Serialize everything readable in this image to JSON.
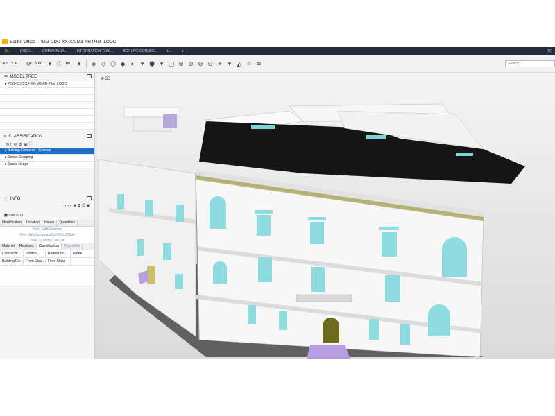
{
  "app": {
    "title": "Solibri Office - PDG-CDC-XX-XX-M3-AR-Pilot_LODC",
    "tabs": [
      "N...",
      "CHEC...",
      "COMMUNICA...",
      "INFORMATION TAKE...",
      "BCF LIVE CONNEC...",
      "L..."
    ],
    "tab_plus": "+",
    "right_label": "TO"
  },
  "toolbar": {
    "spin_label": "Spin",
    "info_label": "Info",
    "search_placeholder": "Search"
  },
  "model_tree": {
    "title": "MODEL TREE",
    "items": [
      "PDG-CDC-XX-XX-M3-AR-Pilot_LODC"
    ]
  },
  "classification": {
    "title": "CLASSIFICATION",
    "items": [
      "Building Elements - General",
      "Space Grouping",
      "Space Usage"
    ]
  },
  "info": {
    "title": "INFO",
    "selected": "Slab.0.16",
    "tabs": [
      "Identification",
      "Location",
      "Issues",
      "Quantities"
    ],
    "links": [
      "Pset_SlabCommon",
      "Pset_ReinforcementBarPitchOfSlab",
      "Pset_QuantityTakeOff"
    ],
    "tabs2": [
      "Material",
      "Relations",
      "Classification",
      "Hyperlinks"
    ],
    "columns": [
      "Classificat...",
      "Source",
      "Reference",
      "Name"
    ],
    "rows": [
      [
        "Building Ele...",
        "From Clas...",
        "Floor Slabs",
        ""
      ]
    ]
  },
  "viewport": {
    "label": "3D"
  }
}
